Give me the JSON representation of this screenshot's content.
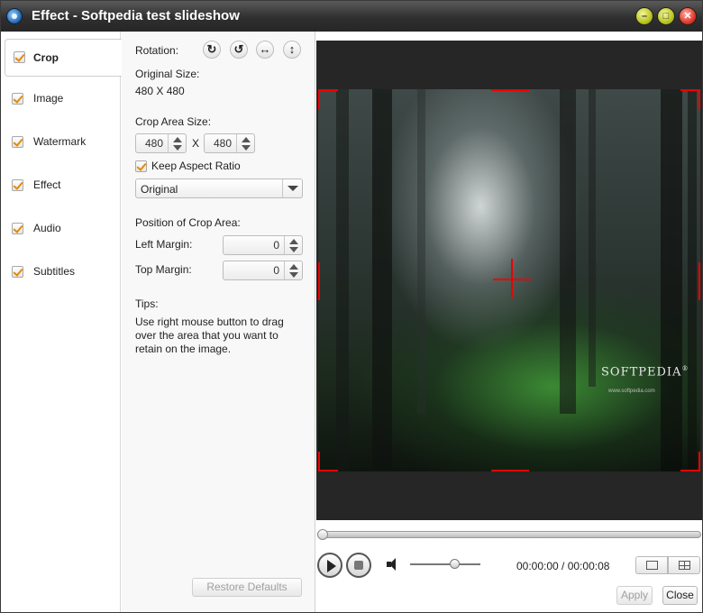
{
  "window": {
    "title": "Effect - Softpedia test slideshow"
  },
  "sidebar": {
    "items": [
      {
        "label": "Crop",
        "checked": true,
        "active": true
      },
      {
        "label": "Image",
        "checked": true
      },
      {
        "label": "Watermark",
        "checked": true
      },
      {
        "label": "Effect",
        "checked": true
      },
      {
        "label": "Audio",
        "checked": true
      },
      {
        "label": "Subtitles",
        "checked": true
      }
    ]
  },
  "crop": {
    "rotation_label": "Rotation:",
    "original_size_label": "Original Size:",
    "original_size_value": "480 X 480",
    "crop_area_label": "Crop Area Size:",
    "width": "480",
    "times": "X",
    "height": "480",
    "keep_aspect_label": "Keep Aspect Ratio",
    "aspect_option": "Original",
    "position_label": "Position of Crop Area:",
    "left_margin_label": "Left Margin:",
    "left_margin_value": "0",
    "top_margin_label": "Top Margin:",
    "top_margin_value": "0",
    "tips_label": "Tips:",
    "tips_text": "Use right mouse button to drag over the area that you want to retain on the image.",
    "restore_label": "Restore Defaults"
  },
  "preview": {
    "logo_text": "SOFTPEDIA",
    "logo_mark": "®",
    "logo_url": "www.softpedia.com"
  },
  "player": {
    "time_display": "00:00:00 / 00:00:08",
    "volume_level": 0.63,
    "seek_position": 0.0
  },
  "footer": {
    "apply_label": "Apply",
    "close_label": "Close"
  },
  "colors": {
    "accent": "#e58a00",
    "crop_marker": "#e00000",
    "titlebar": "#2f2f2f"
  }
}
